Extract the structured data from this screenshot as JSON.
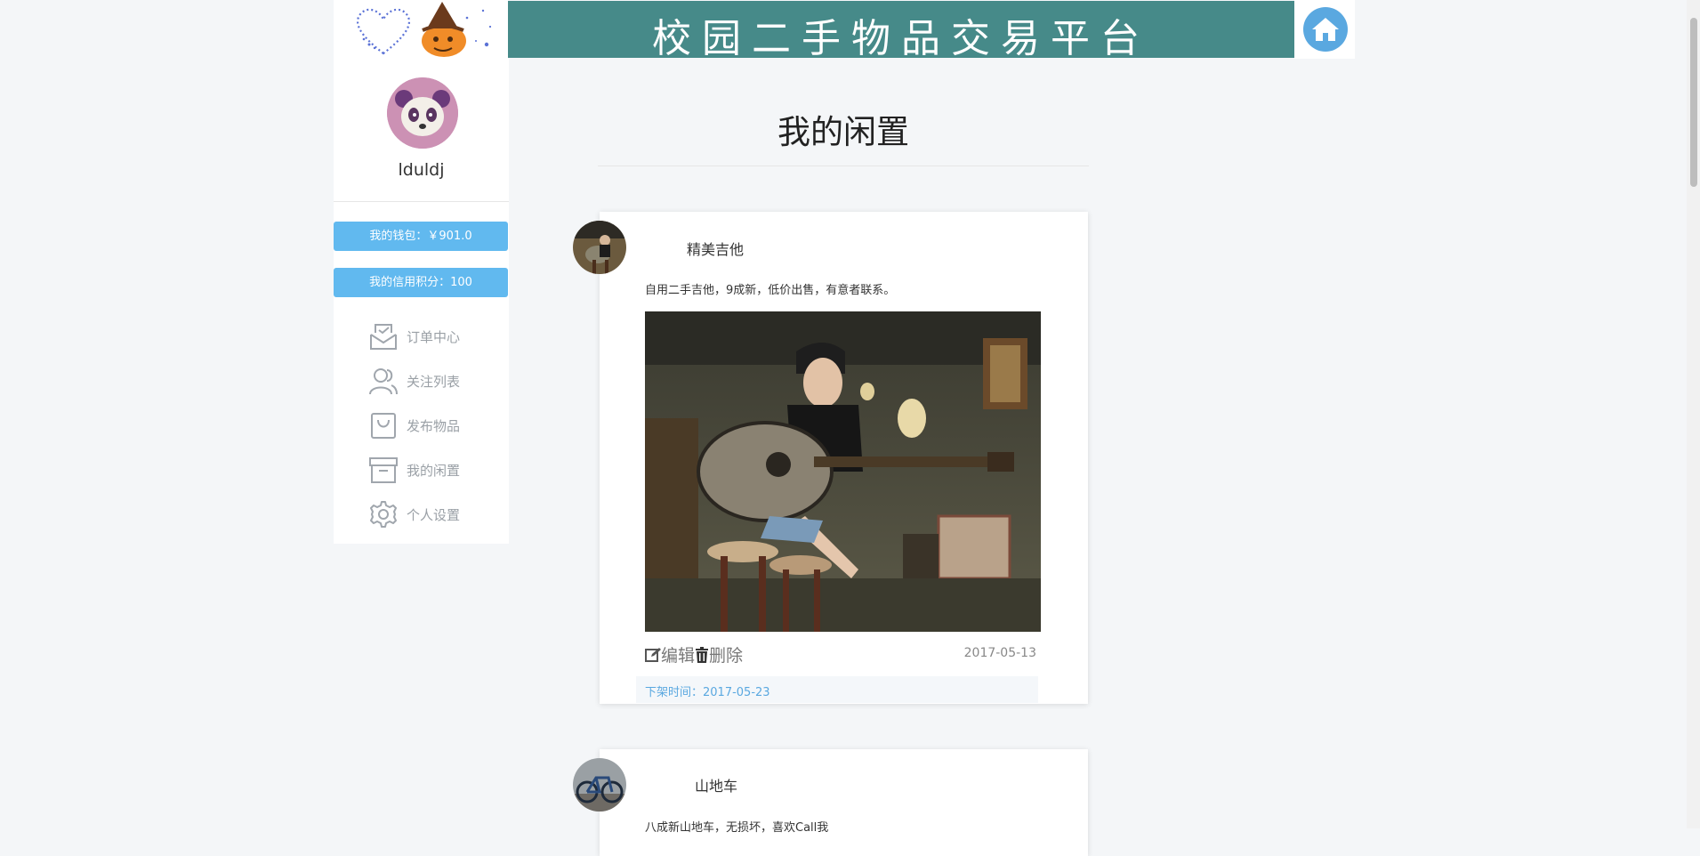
{
  "header": {
    "title": "校园二手物品交易平台",
    "home_icon": "home-icon",
    "band_color": "#468a89"
  },
  "sidebar": {
    "username": "lduldj",
    "wallet_label": "我的钱包：￥901.0",
    "credit_label": "我的信用积分：100",
    "nav": [
      {
        "label": "订单中心",
        "icon": "envelope-icon"
      },
      {
        "label": "关注列表",
        "icon": "users-icon"
      },
      {
        "label": "发布物品",
        "icon": "bag-icon"
      },
      {
        "label": "我的闲置",
        "icon": "archive-box-icon"
      },
      {
        "label": "个人设置",
        "icon": "gear-icon"
      }
    ],
    "accent_color": "#61b9ef"
  },
  "main": {
    "title": "我的闲置",
    "items": [
      {
        "title": "精美吉他",
        "desc": "自用二手吉他，9成新，低价出售，有意者联系。",
        "edit_label": "编辑",
        "delete_label": "删除",
        "date": "2017-05-13",
        "offline_label": "下架时间：2017-05-23"
      },
      {
        "title": "山地车",
        "desc": "八成新山地车，无损坏，喜欢Call我"
      }
    ]
  }
}
